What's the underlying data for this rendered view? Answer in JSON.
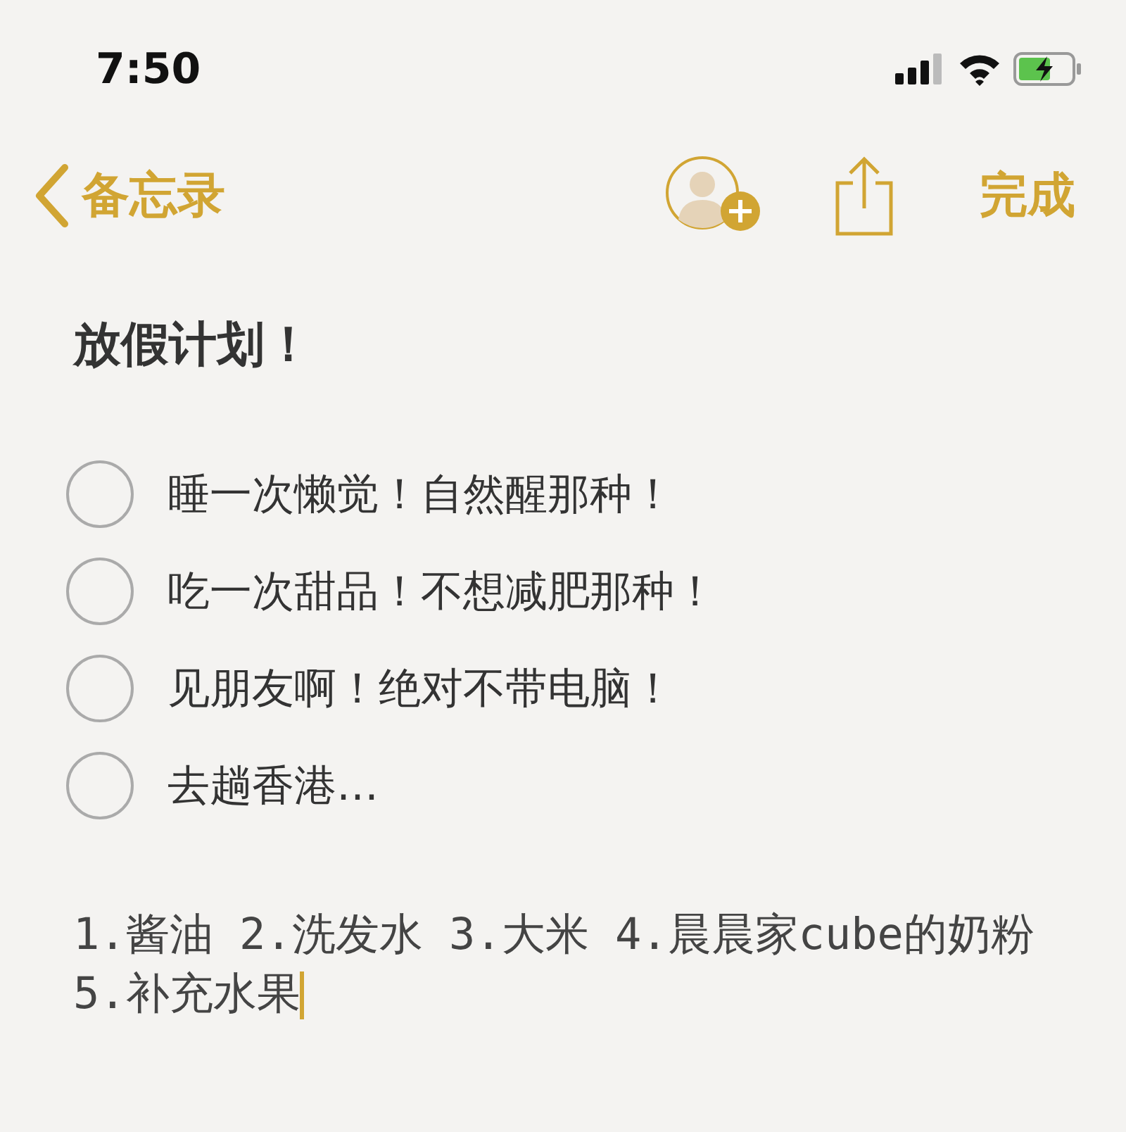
{
  "status_bar": {
    "time": "7:50"
  },
  "nav": {
    "back": "备忘录",
    "done": "完成"
  },
  "note": {
    "title": "放假计划！",
    "checklist": [
      {
        "text": "睡一次懒觉！自然醒那种！",
        "checked": false
      },
      {
        "text": "吃一次甜品！不想减肥那种！",
        "checked": false
      },
      {
        "text": "见朋友啊！绝对不带电脑！",
        "checked": false
      },
      {
        "text": "去趟香港…",
        "checked": false
      }
    ],
    "body": "1.酱油 2.洗发水 3.大米 4.晨晨家cube的奶粉 5.补充水果"
  }
}
